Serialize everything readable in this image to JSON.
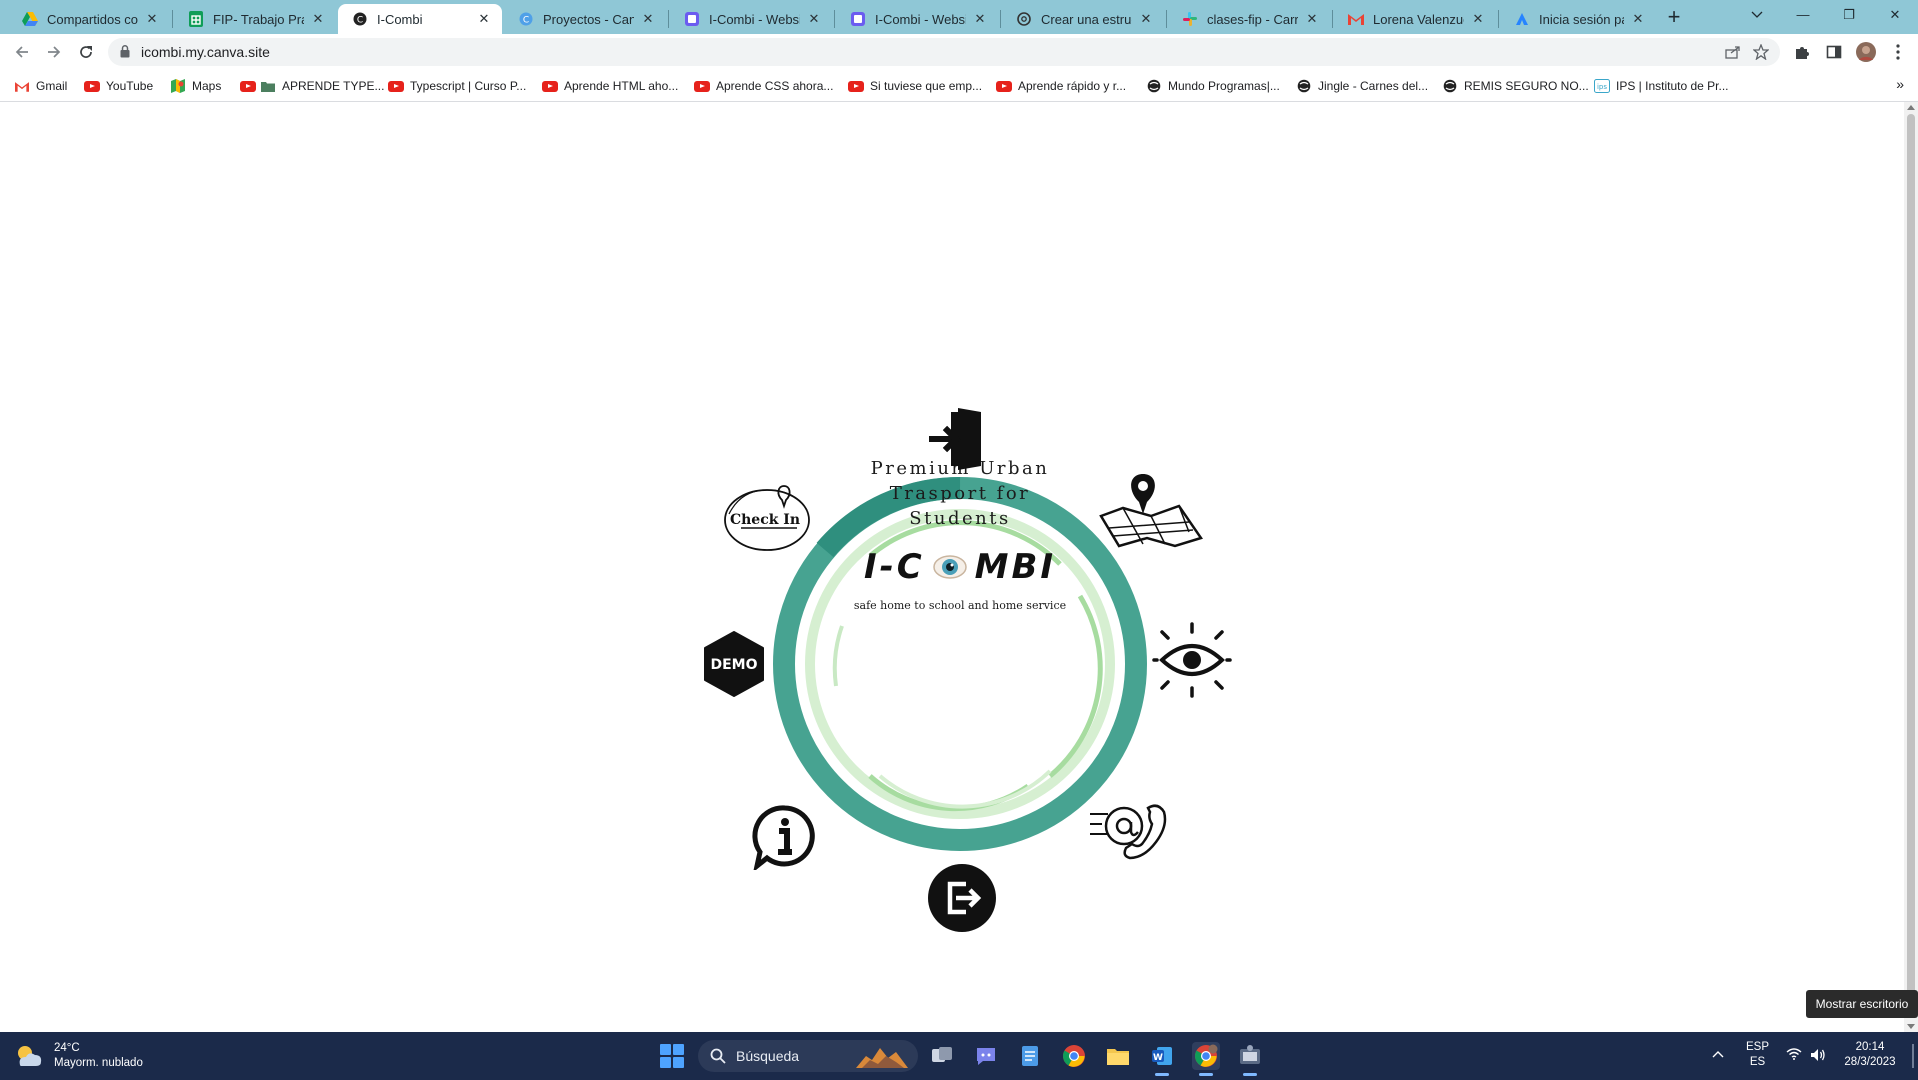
{
  "browser": {
    "tabs": [
      {
        "title": "Compartidos conm",
        "icon": "google-drive-icon",
        "active": false
      },
      {
        "title": "FIP- Trabajo Practic",
        "icon": "google-sheets-icon",
        "active": false
      },
      {
        "title": "I-Combi",
        "icon": "canva-site-icon",
        "active": true
      },
      {
        "title": "Proyectos - Canva",
        "icon": "canva-icon",
        "active": false
      },
      {
        "title": "I-Combi - Website",
        "icon": "canva-website-icon",
        "active": false
      },
      {
        "title": "I-Combi - Website",
        "icon": "canva-website-icon",
        "active": false
      },
      {
        "title": "Crear una estructu",
        "icon": "openai-icon",
        "active": false
      },
      {
        "title": "clases-fip - Carrera",
        "icon": "slack-icon",
        "active": false
      },
      {
        "title": "Lorena Valenzuela",
        "icon": "gmail-icon",
        "active": false
      },
      {
        "title": "Inicia sesión para c",
        "icon": "atlassian-icon",
        "active": false
      }
    ],
    "address": "icombi.my.canva.site",
    "bookmarks": [
      {
        "label": "Gmail",
        "icon": "gmail-icon"
      },
      {
        "label": "YouTube",
        "icon": "youtube-icon"
      },
      {
        "label": "Maps",
        "icon": "maps-icon"
      },
      {
        "label": "APRENDE TYPE...",
        "icon": "youtube-icon"
      },
      {
        "label": "Typescript | Curso P...",
        "icon": "youtube-icon"
      },
      {
        "label": "Aprende HTML aho...",
        "icon": "youtube-icon"
      },
      {
        "label": "Aprende CSS ahora...",
        "icon": "youtube-icon"
      },
      {
        "label": "Si tuviese que emp...",
        "icon": "youtube-icon"
      },
      {
        "label": "Aprende rápido y r...",
        "icon": "youtube-icon"
      },
      {
        "label": "Mundo Programas|...",
        "icon": "globe-icon"
      },
      {
        "label": "Jingle - Carnes del...",
        "icon": "globe-icon"
      },
      {
        "label": "REMIS SEGURO NO...",
        "icon": "globe-icon"
      },
      {
        "label": "IPS | Instituto de Pr...",
        "icon": "ips-icon"
      }
    ]
  },
  "hero": {
    "tagline": [
      "Premium Urban",
      "Trasport for",
      "Students"
    ],
    "brand_left": "I-C",
    "brand_right": "MBI",
    "subtitle": "safe home to school and home service",
    "checkin_label": "Check In",
    "demo_label": "DEMO",
    "colors": {
      "ring_dark": "#2f8f7e",
      "ring_mid": "#47a391",
      "ring_light": "#a7dca0",
      "ring_pale": "#d6efd1"
    }
  },
  "nav_icons": [
    {
      "name": "login-icon"
    },
    {
      "name": "map-location-icon"
    },
    {
      "name": "eye-icon"
    },
    {
      "name": "contact-icon"
    },
    {
      "name": "logout-icon"
    },
    {
      "name": "info-icon"
    },
    {
      "name": "demo-icon"
    },
    {
      "name": "checkin-icon"
    }
  ],
  "tooltip": "Mostrar escritorio",
  "taskbar": {
    "temperature": "24°C",
    "weather": "Mayorm. nublado",
    "search_placeholder": "Búsqueda",
    "language": "ESP",
    "layout": "ES",
    "time": "20:14",
    "date": "28/3/2023"
  }
}
